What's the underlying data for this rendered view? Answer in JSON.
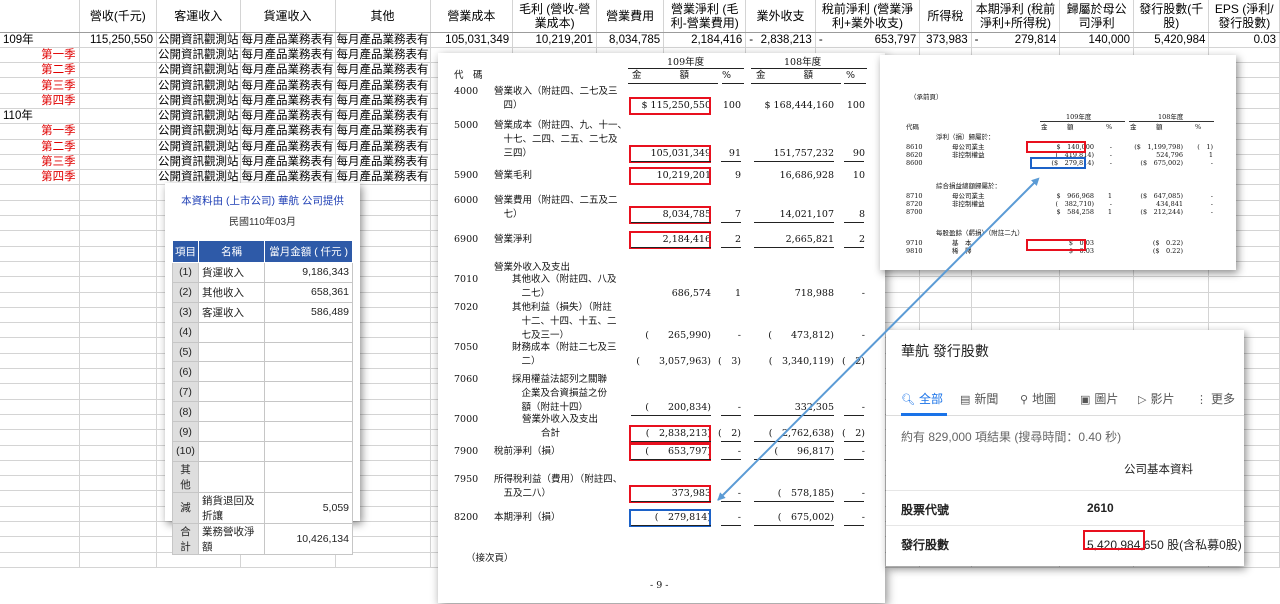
{
  "spreadsheet": {
    "headers": [
      "",
      "營收(千元)",
      "客運收入",
      "貨運收入",
      "其他",
      "營業成本",
      "毛利\n(營收-營業成本)",
      "營業費用",
      "營業淨利\n(毛利-營業費用)",
      "業外收支",
      "稅前淨利\n(營業淨利+業外收支)",
      "所得稅",
      "本期淨利\n(稅前淨利+所得稅)",
      "歸屬於母公司淨利",
      "發行股數(千股)",
      "EPS\n(淨利/發行股數)"
    ],
    "row109": {
      "label": "109年",
      "revenue": "115,250,550",
      "passenger": "公開資訊觀測站",
      "cargo": "每月產品業務表有",
      "other": "每月產品業務表有",
      "cost": "105,031,349",
      "gross": "10,219,201",
      "opex": "8,034,785",
      "opinc": "2,184,416",
      "nonop_dash": "-",
      "nonop": "2,838,213",
      "pretax_dash": "-",
      "pretax": "653,797",
      "tax": "373,983",
      "net_dash": "-",
      "net": "279,814",
      "parent": "140,000",
      "shares": "5,420,984",
      "eps": "0.03"
    },
    "quarters109": [
      "第一季",
      "第二季",
      "第三季",
      "第四季"
    ],
    "label110": "110年",
    "quarters110": [
      "第一季",
      "第二季",
      "第三季",
      "第四季"
    ],
    "quarter_source": "公開資訊觀測站",
    "quarter_cargo": "每月產品業務表有",
    "quarter_other": "每月產品業務表有"
  },
  "revenue_panel": {
    "title": "本資料由  (上市公司) 華航  公司提供",
    "subtitle": "民國110年03月",
    "headers": [
      "項目",
      "名稱",
      "當月金額 ( 仟元 )"
    ],
    "rows": [
      [
        "(1)",
        "貨運收入",
        "9,186,343"
      ],
      [
        "(2)",
        "其他收入",
        "658,361"
      ],
      [
        "(3)",
        "客運收入",
        "586,489"
      ],
      [
        "(4)",
        "",
        ""
      ],
      [
        "(5)",
        "",
        ""
      ],
      [
        "(6)",
        "",
        ""
      ],
      [
        "(7)",
        "",
        ""
      ],
      [
        "(8)",
        "",
        ""
      ],
      [
        "(9)",
        "",
        ""
      ],
      [
        "(10)",
        "",
        ""
      ],
      [
        "其他",
        "",
        ""
      ],
      [
        "減",
        "銷貨退回及折讓",
        "5,059"
      ],
      [
        "合計",
        "業務營收淨額",
        "10,426,134"
      ]
    ]
  },
  "statement": {
    "col_code": "代　碼",
    "year_a": "109年度",
    "year_b": "108年度",
    "amount": "金　　　　額",
    "pct": "%",
    "rows": [
      {
        "code": "4000",
        "label": "營業收入（附註四、二七及三\n　四）",
        "a": "$ 115,250,550",
        "ap": "100",
        "b": "$ 168,444,160",
        "bp": "100"
      },
      {
        "code": "5000",
        "label": "營業成本（附註四、九、十一、\n　十七、二四、二五、二七及\n　三四）",
        "a": "105,031,349",
        "ap": "91",
        "b": "151,757,232",
        "bp": "90"
      },
      {
        "code": "5900",
        "label": "營業毛利",
        "a": "10,219,201",
        "ap": "9",
        "b": "16,686,928",
        "bp": "10"
      },
      {
        "code": "6000",
        "label": "營業費用（附註四、二五及二\n　七）",
        "a": "8,034,785",
        "ap": "7",
        "b": "14,021,107",
        "bp": "8"
      },
      {
        "code": "6900",
        "label": "營業淨利",
        "a": "2,184,416",
        "ap": "2",
        "b": "2,665,821",
        "bp": "2"
      },
      {
        "code": "",
        "label": "營業外收入及支出",
        "a": "",
        "ap": "",
        "b": "",
        "bp": ""
      },
      {
        "code": "7010",
        "label": "其他收入（附註四、八及\n　二七）",
        "a": "686,574",
        "ap": "1",
        "b": "718,988",
        "bp": "-"
      },
      {
        "code": "7020",
        "label": "其他利益（損失）（附註\n　十二、十四、十五、二\n　七及三一）",
        "a": "(　　265,990)",
        "ap": "-",
        "b": "(　　473,812)",
        "bp": "-"
      },
      {
        "code": "7050",
        "label": "財務成本（附註二七及三\n　二）",
        "a": "(　　3,057,963)",
        "ap": "(　3)",
        "b": "(　3,340,119)",
        "bp": "(　2)"
      },
      {
        "code": "7060",
        "label": "採用權益法認列之關聯\n　企業及合資損益之份\n　額（附註十四）",
        "a": "(　　200,834)",
        "ap": "-",
        "b": "332,305",
        "bp": "-"
      },
      {
        "code": "7000",
        "label": "營業外收入及支出\n　　合計",
        "a": "(　2,838,213)",
        "ap": "(　2)",
        "b": "(　2,762,638)",
        "bp": "(　2)"
      },
      {
        "code": "7900",
        "label": "稅前淨利（損）",
        "a": "(　　653,797)",
        "ap": "-",
        "b": "(　　96,817)",
        "bp": "-"
      },
      {
        "code": "7950",
        "label": "所得稅利益（費用）（附註四、\n　五及二八）",
        "a": "373,983",
        "ap": "-",
        "b": "(　578,185)",
        "bp": "-"
      },
      {
        "code": "8200",
        "label": "本期淨利（損）",
        "a": "(　279,814)",
        "ap": "-",
        "b": "(　675,002)",
        "bp": "-"
      }
    ],
    "continued": "（接次頁）",
    "page_no": "- 9 -"
  },
  "equity": {
    "carried": "（承前頁）",
    "year_a": "109年度",
    "year_b": "108年度",
    "amount": "金　　　額",
    "pct": "%",
    "code": "代碼",
    "sec1": "淨利（損）歸屬於：",
    "sec2": "綜合損益總額歸屬於：",
    "sec3": "每股盈餘（虧損）（附註二九）",
    "rows1": [
      {
        "code": "8610",
        "label": "母公司業主",
        "a": "$　140,000",
        "ap": "-",
        "b": "($　1,199,798)",
        "bp": "(　1)"
      },
      {
        "code": "8620",
        "label": "非控制權益",
        "a": "(　419,814)",
        "ap": "-",
        "b": "524,796",
        "bp": "1"
      },
      {
        "code": "8600",
        "label": "",
        "a": "($　279,814)",
        "ap": "-",
        "b": "($　675,002)",
        "bp": "-"
      }
    ],
    "rows2": [
      {
        "code": "8710",
        "label": "母公司業主",
        "a": "$　966,968",
        "ap": "1",
        "b": "($　647,085)",
        "bp": "-"
      },
      {
        "code": "8720",
        "label": "非控制權益",
        "a": "(　382,710)",
        "ap": "-",
        "b": "434,841",
        "bp": "-"
      },
      {
        "code": "8700",
        "label": "",
        "a": "$　584,258",
        "ap": "1",
        "b": "($　212,244)",
        "bp": "-"
      }
    ],
    "rows3": [
      {
        "code": "9710",
        "label": "基　本",
        "a": "$　0.03",
        "b": "($　0.22)"
      },
      {
        "code": "9810",
        "label": "稀　釋",
        "a": "$　0.03",
        "b": "($　0.22)"
      }
    ]
  },
  "search": {
    "title": "華航 發行股數",
    "tabs": [
      {
        "icon": "search-icon",
        "label": "全部"
      },
      {
        "icon": "news-icon",
        "label": "新聞"
      },
      {
        "icon": "map-pin-icon",
        "label": "地圖"
      },
      {
        "icon": "image-icon",
        "label": "圖片"
      },
      {
        "icon": "video-icon",
        "label": "影片"
      },
      {
        "icon": "more-icon",
        "label": "更多"
      }
    ],
    "stats": "約有 829,000 項結果 (搜尋時間：0.40 秒)",
    "info_title": "公司基本資料",
    "rows": [
      {
        "key": "股票代號",
        "value": "2610"
      },
      {
        "key": "發行股數",
        "value": "5,420,984,650 股(含私募0股)"
      }
    ]
  },
  "colors": {
    "highlight_red": "#e8101e",
    "highlight_blue": "#1c62c8",
    "quarter_red": "#e00000",
    "panel_blue": "#2e5aa8",
    "link_blue": "#1a73e8",
    "arrow": "#5b9bd5"
  }
}
